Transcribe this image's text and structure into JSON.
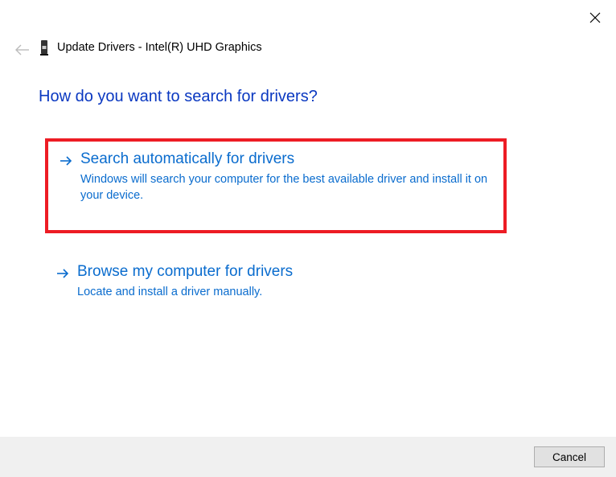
{
  "header": {
    "title": "Update Drivers - Intel(R) UHD Graphics"
  },
  "question": "How do you want to search for drivers?",
  "options": [
    {
      "title": "Search automatically for drivers",
      "description": "Windows will search your computer for the best available driver and install it on your device."
    },
    {
      "title": "Browse my computer for drivers",
      "description": "Locate and install a driver manually."
    }
  ],
  "footer": {
    "cancel": "Cancel"
  }
}
